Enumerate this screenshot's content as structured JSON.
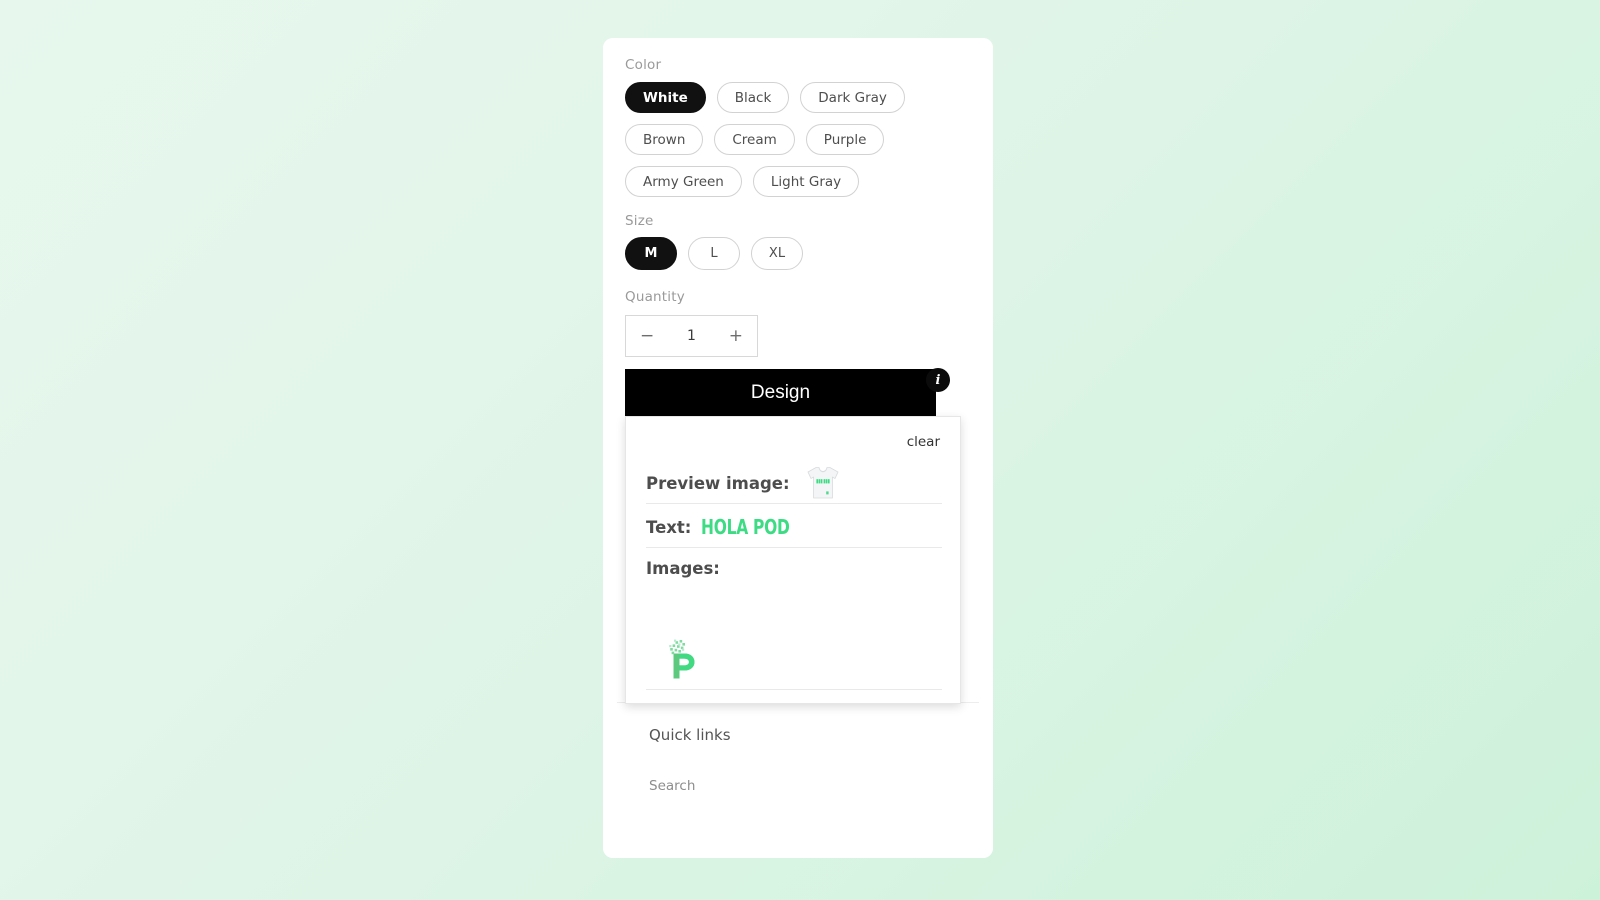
{
  "theme": {
    "accent_green": "#3ddc84",
    "selected_bg": "#111111",
    "button_bg": "#000000",
    "page_bg_from": "#e7f7ed",
    "page_bg_to": "#cdf2da"
  },
  "product": {
    "color": {
      "label": "Color",
      "selected": "White",
      "options": [
        {
          "label": "White",
          "selected": true
        },
        {
          "label": "Black",
          "selected": false
        },
        {
          "label": "Dark Gray",
          "selected": false
        },
        {
          "label": "Brown",
          "selected": false
        },
        {
          "label": "Cream",
          "selected": false
        },
        {
          "label": "Purple",
          "selected": false
        },
        {
          "label": "Army Green",
          "selected": false
        },
        {
          "label": "Light Gray",
          "selected": false
        }
      ]
    },
    "size": {
      "label": "Size",
      "selected": "M",
      "options": [
        {
          "label": "M",
          "selected": true
        },
        {
          "label": "L",
          "selected": false
        },
        {
          "label": "XL",
          "selected": false
        }
      ]
    },
    "quantity": {
      "label": "Quantity",
      "value": "1",
      "decrement_label": "−",
      "increment_label": "+"
    },
    "design_button": {
      "label": "Design",
      "info_badge_label": "i"
    }
  },
  "design_panel": {
    "clear_label": "clear",
    "preview_image_label": "Preview image:",
    "preview_image_alt": "white t-shirt with HOLA POD print",
    "text_label": "Text:",
    "text_value": "HOLA POD",
    "images_label": "Images:",
    "image_alt": "green pixel P logo"
  },
  "footer": {
    "title": "Quick links",
    "links": [
      {
        "label": "Search"
      }
    ]
  }
}
